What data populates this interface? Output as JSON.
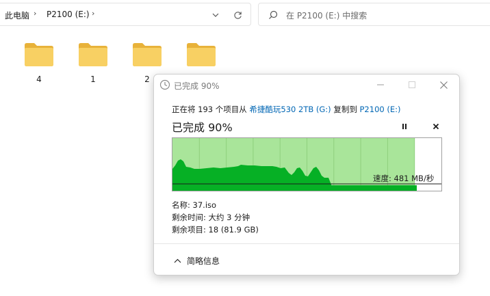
{
  "address_bar": {
    "crumbs": [
      "此电脑",
      "P2100 (E:)"
    ],
    "search_placeholder": "在 P2100 (E:) 中搜索"
  },
  "folders": [
    {
      "label": "4"
    },
    {
      "label": "1"
    },
    {
      "label": "2"
    },
    {
      "label": ""
    }
  ],
  "dialog": {
    "title": "已完成 90%",
    "copy_line": {
      "prefix": "正在将 193 个项目从",
      "source": "希捷酷玩530 2TB (G:)",
      "middle": "复制到",
      "dest": "P2100 (E:)"
    },
    "progress_text": "已完成 90%",
    "progress_percent": 90,
    "speed_text": "速度: 481 MB/秒",
    "info": {
      "name": "名称: 37.iso",
      "time_left": "剩余时间: 大约 3 分钟",
      "items_left": "剩余项目: 18 (81.9 GB)"
    },
    "footer_label": "简略信息"
  },
  "colors": {
    "accent_link": "#0066b4",
    "progress_fill": "#a9e59a",
    "graph_area": "#06b025",
    "folder_yellow": "#f8d063"
  }
}
